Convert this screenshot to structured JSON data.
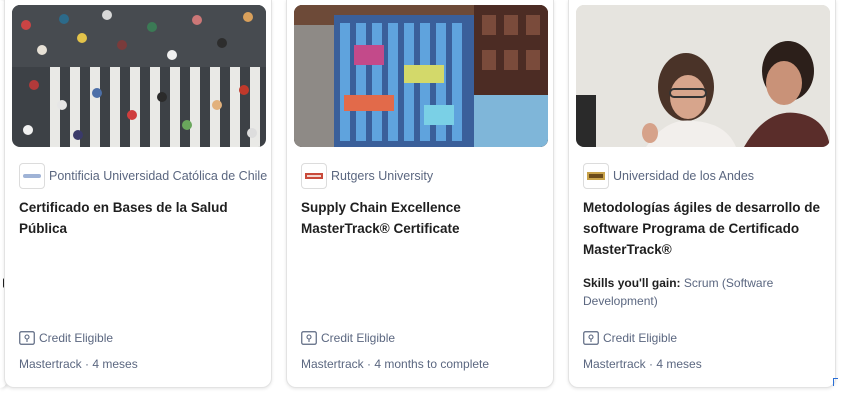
{
  "cards": [
    {
      "partner": "Pontificia Universidad Católica de Chile",
      "title": "Certificado en Bases de la Salud Pública",
      "credit": "Credit Eligible",
      "meta": "Mastertrack · 4 meses"
    },
    {
      "partner": "Rutgers University",
      "title": "Supply Chain Excellence MasterTrack® Certificate",
      "credit": "Credit Eligible",
      "meta": "Mastertrack · 4 months to complete"
    },
    {
      "partner": "Universidad de los Andes",
      "title": "Metodologías ágiles de desarrollo de software Programa de Certificado MasterTrack®",
      "skills_label": "Skills you'll gain:",
      "skills_value": "Scrum (Software Development)",
      "credit": "Credit Eligible",
      "meta": "Mastertrack · 4 meses"
    }
  ],
  "icons": {
    "credit": "credit-card-icon",
    "partner_logo": "university-logo-icon"
  },
  "colors": {
    "secondary_text": "#5b6780",
    "primary_text": "#1f1f1f"
  }
}
